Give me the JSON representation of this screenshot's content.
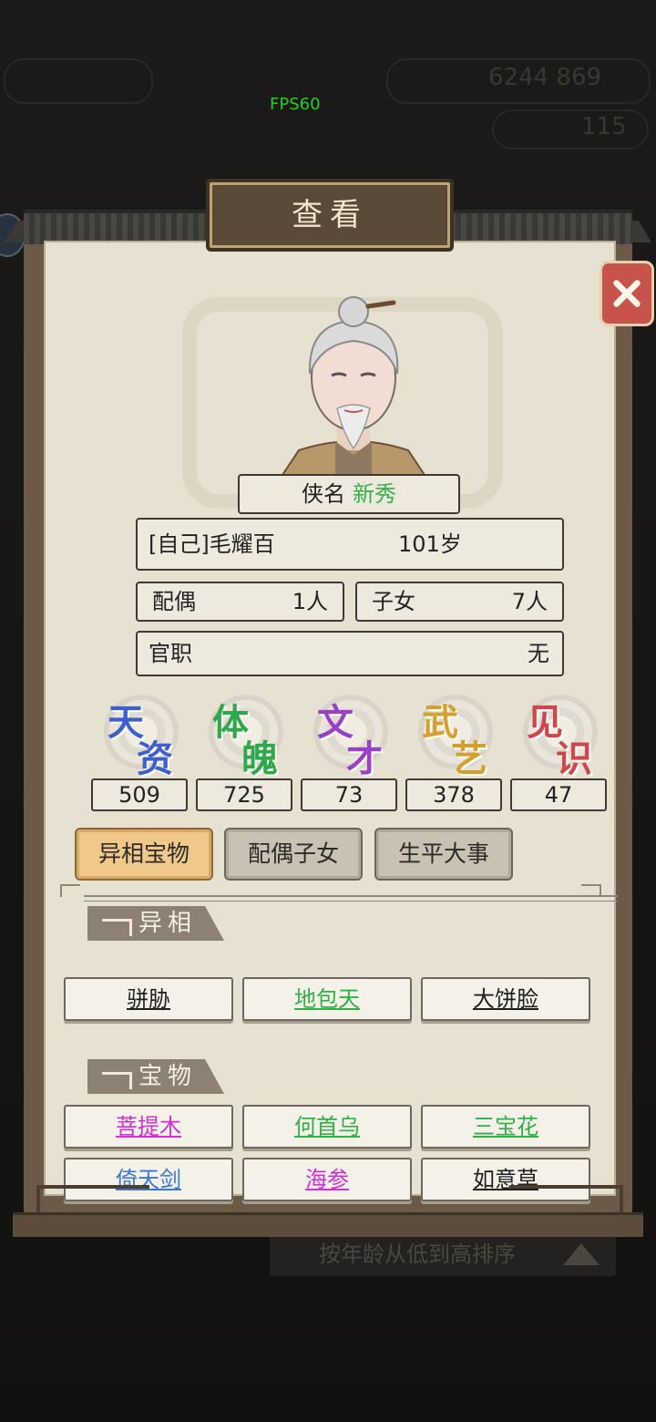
{
  "status": {
    "fps": "FPS60"
  },
  "dialog": {
    "title": "查看"
  },
  "profile": {
    "name_label": "侠名",
    "name_value": "新秀",
    "identity": "[自己]毛耀百",
    "age": "101岁",
    "spouse_label": "配偶",
    "spouse_value": "1人",
    "children_label": "子女",
    "children_value": "7人",
    "office_label": "官职",
    "office_value": "无"
  },
  "stats": [
    {
      "c1": "天",
      "c2": "资",
      "value": "509",
      "color": "#3d5fd0"
    },
    {
      "c1": "体",
      "c2": "魄",
      "value": "725",
      "color": "#2fa84a"
    },
    {
      "c1": "文",
      "c2": "才",
      "value": "73",
      "color": "#9a3fc8"
    },
    {
      "c1": "武",
      "c2": "艺",
      "value": "378",
      "color": "#d6a02c"
    },
    {
      "c1": "见",
      "c2": "识",
      "value": "47",
      "color": "#d0474b"
    }
  ],
  "tabs": [
    {
      "label": "异相宝物",
      "active": true
    },
    {
      "label": "配偶子女",
      "active": false
    },
    {
      "label": "生平大事",
      "active": false
    }
  ],
  "sections": {
    "traits_title": "异相",
    "treasures_title": "宝物"
  },
  "traits": [
    {
      "label": "骈胁",
      "color": "dark"
    },
    {
      "label": "地包天",
      "color": "green"
    },
    {
      "label": "大饼脸",
      "color": "dark"
    }
  ],
  "treasures": [
    {
      "label": "菩提木",
      "color": "pink"
    },
    {
      "label": "何首乌",
      "color": "green"
    },
    {
      "label": "三宝花",
      "color": "green"
    },
    {
      "label": "倚天剑",
      "color": "blue"
    },
    {
      "label": "海参",
      "color": "pink"
    },
    {
      "label": "如意草",
      "color": "dark"
    }
  ],
  "background": {
    "sort_label": "按年龄从低到高排序",
    "currency": "6244 869",
    "count": "115"
  }
}
